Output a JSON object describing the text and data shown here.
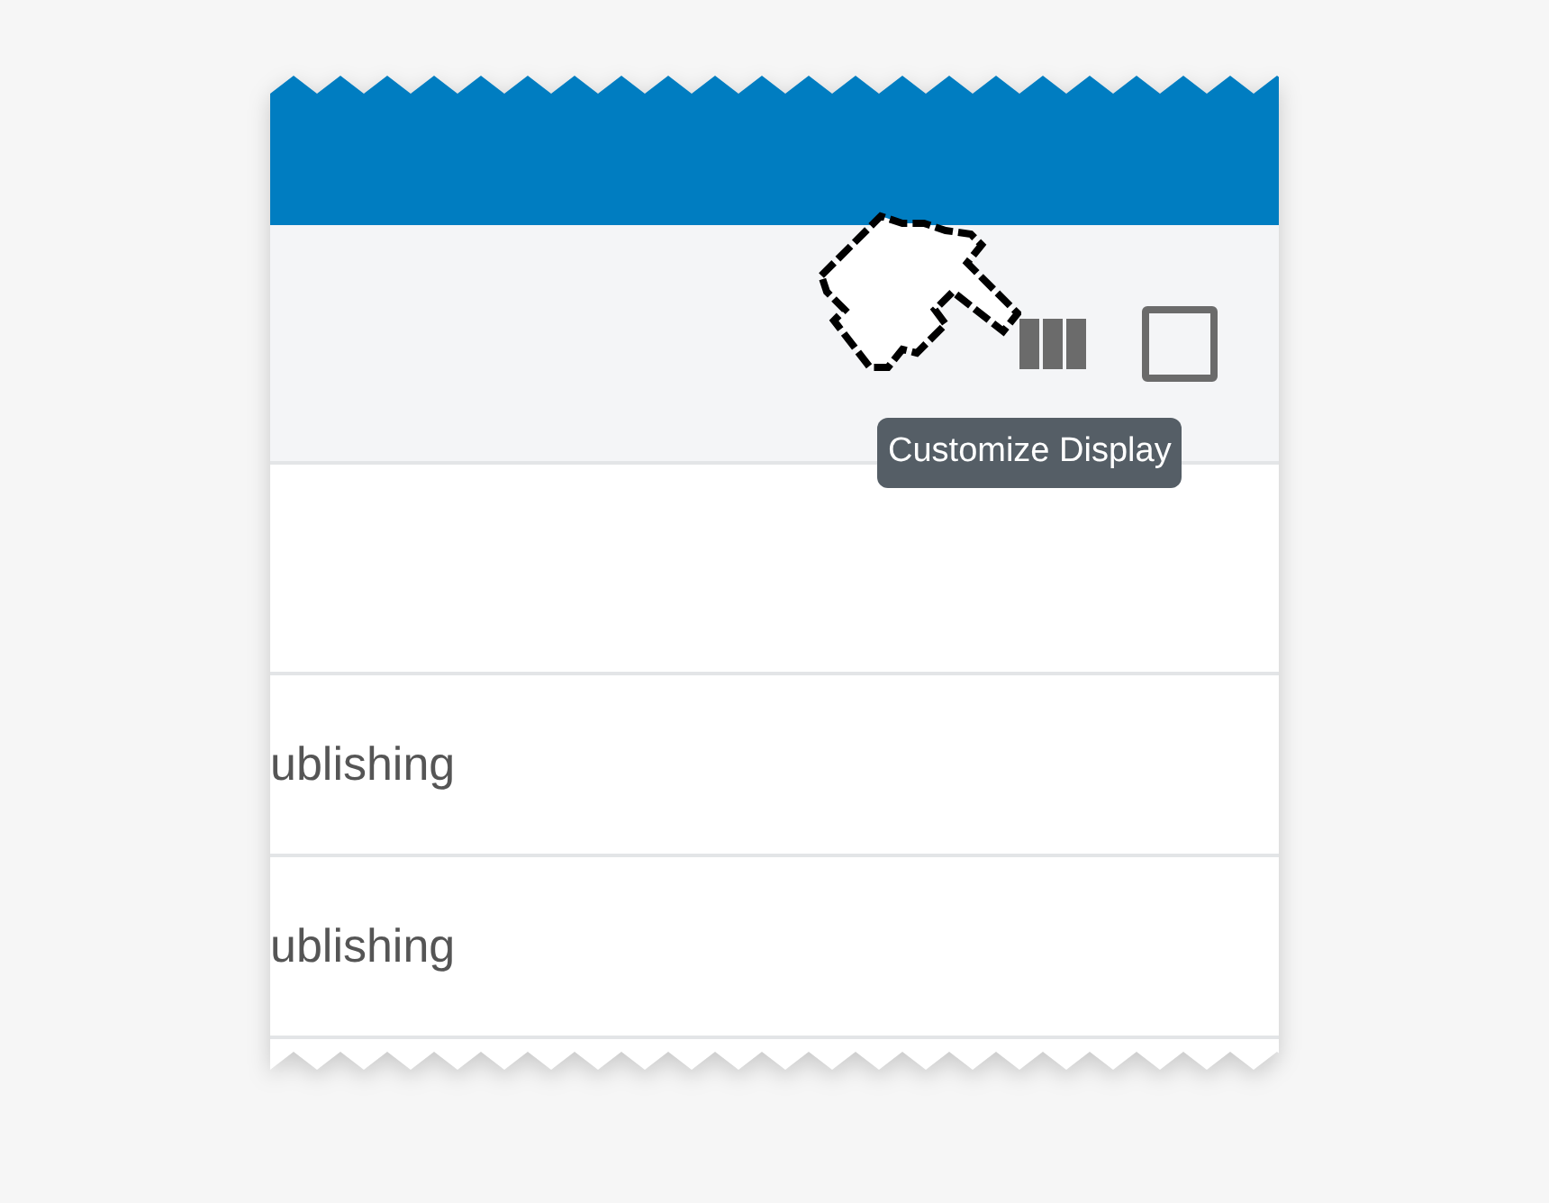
{
  "toolbar": {
    "tooltip": "Customize Display"
  },
  "table": {
    "rows": [
      {
        "column_1": "ublishing"
      },
      {
        "column_1": "ublishing"
      }
    ]
  }
}
